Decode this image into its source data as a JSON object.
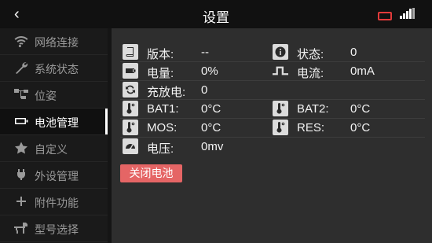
{
  "header": {
    "title": "设置",
    "back": "‹"
  },
  "sidebar": {
    "items": [
      {
        "label": "网络连接",
        "icon": "wifi-icon"
      },
      {
        "label": "系统状态",
        "icon": "wrench-icon"
      },
      {
        "label": "位姿",
        "icon": "hierarchy-icon"
      },
      {
        "label": "电池管理",
        "icon": "battery-icon",
        "active": true
      },
      {
        "label": "自定义",
        "icon": "star-icon"
      },
      {
        "label": "外设管理",
        "icon": "plug-icon"
      },
      {
        "label": "附件功能",
        "icon": "plus-icon"
      },
      {
        "label": "型号选择",
        "icon": "robot-dog-icon"
      }
    ]
  },
  "battery": {
    "version_label": "版本:",
    "version_value": "--",
    "status_label": "状态:",
    "status_value": "0",
    "level_label": "电量:",
    "level_value": "0%",
    "current_label": "电流:",
    "current_value": "0mA",
    "charge_label": "充放电:",
    "charge_value": "0",
    "bat1_label": "BAT1:",
    "bat1_value": "0°C",
    "bat2_label": "BAT2:",
    "bat2_value": "0°C",
    "mos_label": "MOS:",
    "mos_value": "0°C",
    "res_label": "RES:",
    "res_value": "0°C",
    "voltage_label": "电压:",
    "voltage_value": "0mv",
    "close_button": "关闭电池"
  },
  "colors": {
    "accent": "#e56565",
    "status_battery": "#e23b3b"
  }
}
